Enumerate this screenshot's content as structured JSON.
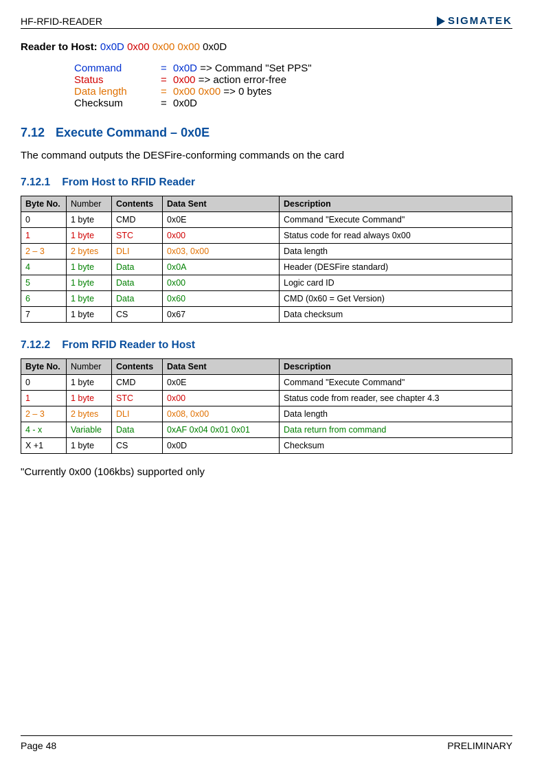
{
  "header": {
    "doc_title": "HF-RFID-READER",
    "logo_text": "SIGMATEK"
  },
  "reader_to_host": {
    "label": "Reader to Host:",
    "bytes_blue": "0x0D",
    "bytes_red": "0x00",
    "bytes_orange": "0x00 0x00",
    "bytes_black": "0x0D"
  },
  "params": {
    "p1_name": "Command",
    "p1_eq": "=",
    "p1_val_blue": "0x0D",
    "p1_rest": " => Command \"Set PPS\"",
    "p2_name": "Status",
    "p2_eq": "=",
    "p2_val_red": "0x00",
    "p2_rest": " => action error-free",
    "p3_name": "Data length",
    "p3_eq": "=",
    "p3_val_orange": " 0x00 0x00",
    "p3_rest": " => 0 bytes",
    "p4_name": "Checksum",
    "p4_eq": "=",
    "p4_rest": "0x0D"
  },
  "sec712": {
    "num": "7.12",
    "title": "Execute Command – 0x0E",
    "desc": "The command outputs the DESFire-conforming commands on the card"
  },
  "sec7121": {
    "num": "7.12.1",
    "title": "From Host to RFID Reader"
  },
  "table_headers": {
    "c1": "Byte No.",
    "c2": "Number",
    "c3": "Contents",
    "c4": "Data Sent",
    "c5": "Description"
  },
  "t1": [
    {
      "cls": "",
      "b": "0",
      "n": "1 byte",
      "c": "CMD",
      "d": "0x0E",
      "e": "Command \"Execute Command\""
    },
    {
      "cls": "red",
      "b": "1",
      "n": "1 byte",
      "c": "STC",
      "d": "0x00",
      "e": "Status code for read always 0x00"
    },
    {
      "cls": "orange",
      "b": "2 – 3",
      "n": "2 bytes",
      "c": "DLI",
      "d": "0x03, 0x00",
      "e": "Data length"
    },
    {
      "cls": "green",
      "b": "4",
      "n": "1 byte",
      "c": "Data",
      "d": "0x0A",
      "e": "Header (DESFire standard)"
    },
    {
      "cls": "green",
      "b": "5",
      "n": "1 byte",
      "c": "Data",
      "d": "0x00",
      "e": "Logic card ID"
    },
    {
      "cls": "green",
      "b": "6",
      "n": "1 byte",
      "c": "Data",
      "d": "0x60",
      "e": "CMD (0x60 = Get Version)"
    },
    {
      "cls": "",
      "b": "7",
      "n": "1 byte",
      "c": "CS",
      "d": "0x67",
      "e": "Data checksum"
    }
  ],
  "sec7122": {
    "num": "7.12.2",
    "title": "From RFID Reader to Host"
  },
  "t2": [
    {
      "cls": "",
      "b": "0",
      "n": "1 byte",
      "c": "CMD",
      "d": "0x0E",
      "e": "Command \"Execute Command\"",
      "ecls": ""
    },
    {
      "cls": "red",
      "b": "1",
      "n": "1 byte",
      "c": "STC",
      "d": "0x00",
      "e": "Status code from reader, see chapter 4.3",
      "ecls": ""
    },
    {
      "cls": "orange",
      "b": "2 – 3",
      "n": "2 bytes",
      "c": "DLI",
      "d": "0x08, 0x00",
      "e": "Data length",
      "ecls": ""
    },
    {
      "cls": "green",
      "b": "4 - x",
      "n": "Variable",
      "c": "Data",
      "d": "0xAF 0x04 0x01 0x01",
      "e": "Data return from command",
      "ecls": "green"
    },
    {
      "cls": "",
      "b": "X +1",
      "n": "1 byte",
      "c": "CS",
      "d": "0x0D",
      "e": "Checksum",
      "ecls": ""
    }
  ],
  "footnote": "\"Currently 0x00 (106kbs) supported only",
  "footer": {
    "page": "Page 48",
    "status": "PRELIMINARY"
  }
}
